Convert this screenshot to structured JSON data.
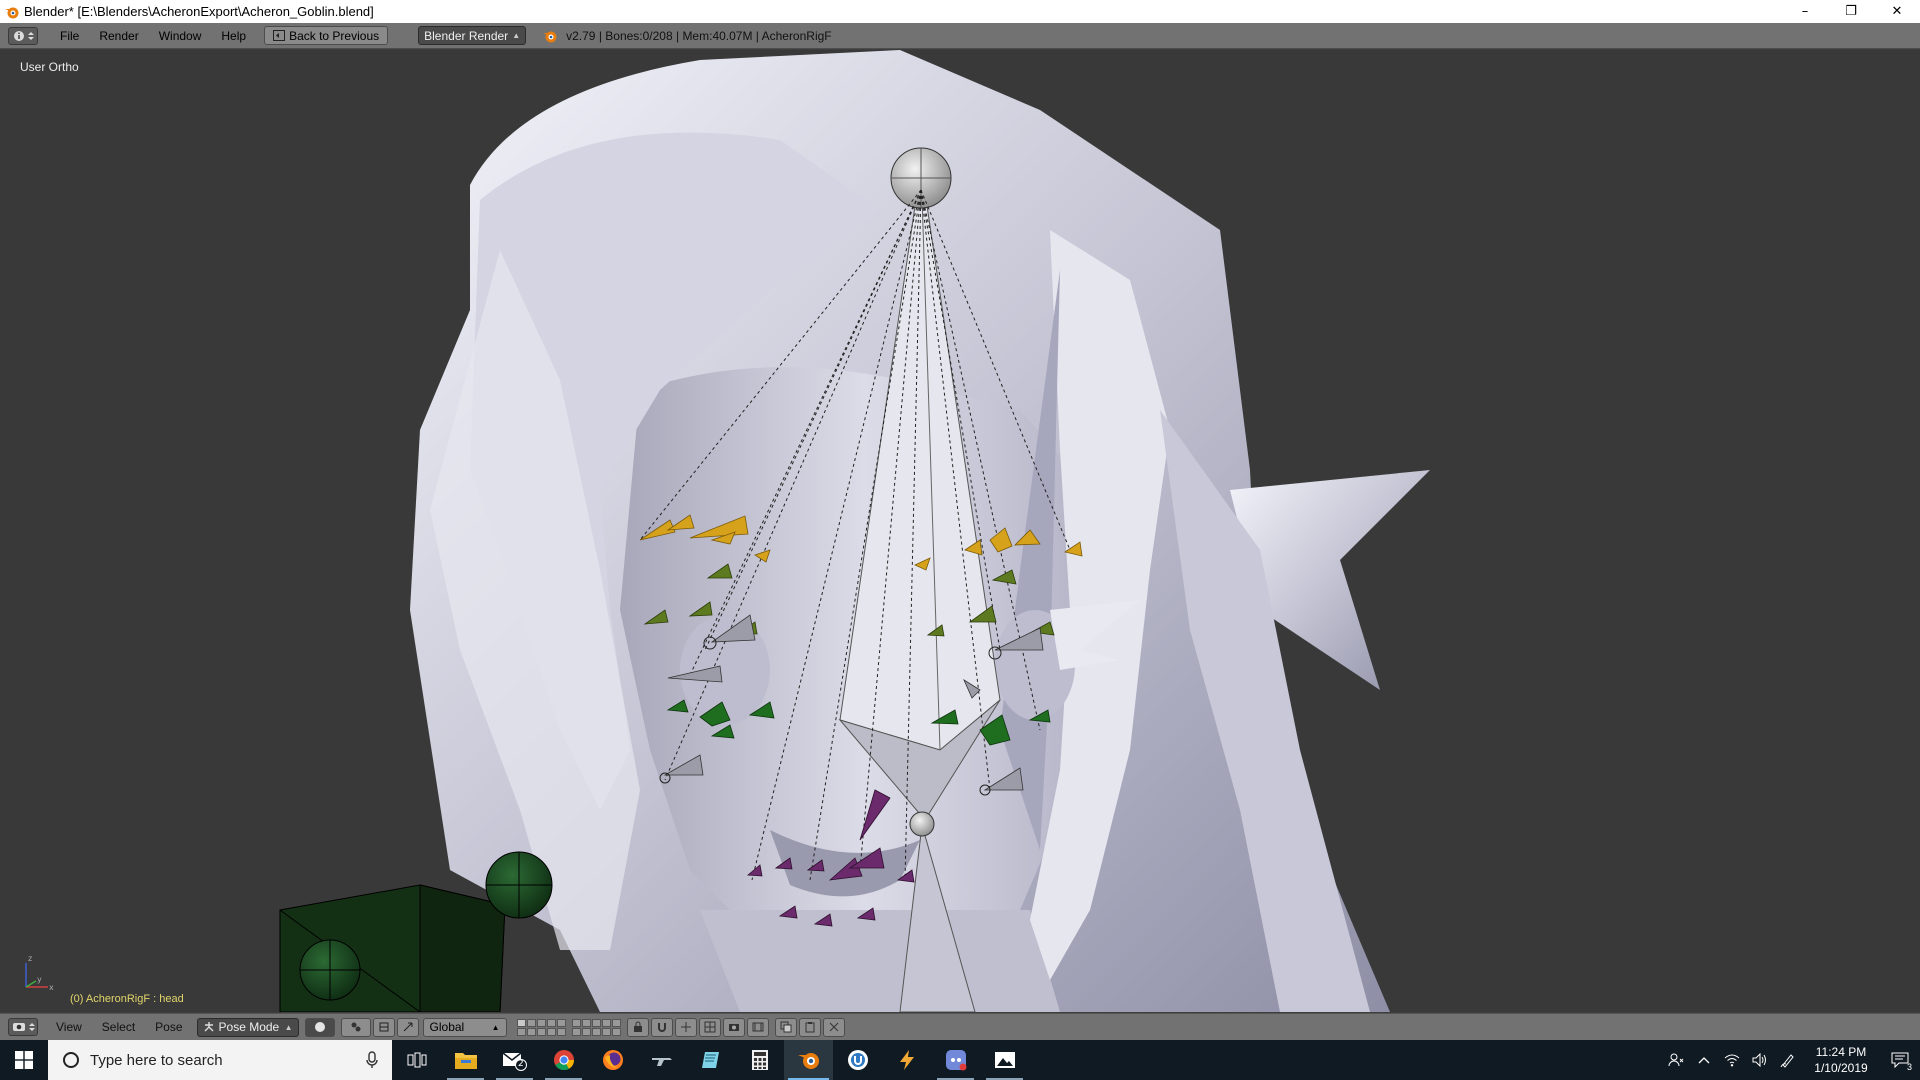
{
  "window": {
    "title": "Blender* [E:\\Blenders\\AcheronExport\\Acheron_Goblin.blend]",
    "minimize": "–",
    "restore": "❐",
    "close": "✕"
  },
  "info_header": {
    "menus": [
      "File",
      "Render",
      "Window",
      "Help"
    ],
    "back_button": "Back to Previous",
    "render_engine": "Blender Render",
    "stats": "v2.79 | Bones:0/208 | Mem:40.07M | AcheronRigF"
  },
  "viewport": {
    "view_label": "User Ortho",
    "object_label": "(0) AcheronRigF : head",
    "axis_labels": {
      "x": "x",
      "y": "y",
      "z": "z"
    }
  },
  "view3d_header": {
    "menus": [
      "View",
      "Select",
      "Pose"
    ],
    "mode": "Pose Mode",
    "orientation": "Global"
  },
  "taskbar": {
    "search_placeholder": "Type here to search",
    "apps": [
      "task-view",
      "file-explorer",
      "mail",
      "chrome",
      "firefox",
      "game",
      "notes",
      "calculator",
      "blender",
      "uplay",
      "vpn",
      "discord",
      "photos"
    ],
    "mail_badge": "2",
    "time": "11:24 PM",
    "date": "1/10/2019",
    "notification_count": "3"
  },
  "colors": {
    "viewport_bg": "#393939",
    "header_bg": "#727272",
    "mesh": "#c9c9d8",
    "bone_yellow": "#d6a21c",
    "bone_olive": "#5d7a21",
    "bone_green": "#1f6e1f",
    "bone_purple": "#6b2a6b",
    "taskbar": "#101a22"
  }
}
